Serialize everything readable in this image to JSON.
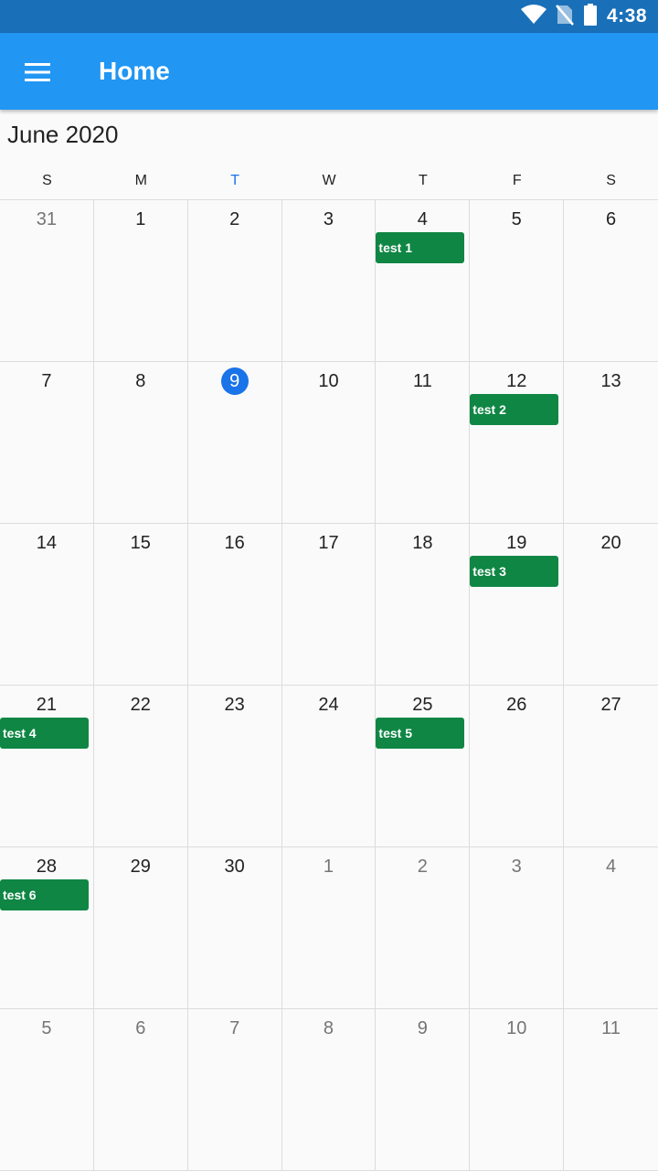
{
  "status_bar": {
    "time": "4:38"
  },
  "app_bar": {
    "title": "Home"
  },
  "calendar": {
    "month_title": "June 2020",
    "weekdays": [
      "S",
      "M",
      "T",
      "W",
      "T",
      "F",
      "S"
    ],
    "today_weekday_index": 2,
    "colors": {
      "today": "#1a73e8",
      "event": "#0f8644",
      "app_bar": "#2196f3"
    },
    "weeks": [
      [
        {
          "day": "31",
          "current_month": false
        },
        {
          "day": "1",
          "current_month": true
        },
        {
          "day": "2",
          "current_month": true
        },
        {
          "day": "3",
          "current_month": true
        },
        {
          "day": "4",
          "current_month": true,
          "event": "test 1"
        },
        {
          "day": "5",
          "current_month": true
        },
        {
          "day": "6",
          "current_month": true
        }
      ],
      [
        {
          "day": "7",
          "current_month": true
        },
        {
          "day": "8",
          "current_month": true
        },
        {
          "day": "9",
          "current_month": true,
          "today": true
        },
        {
          "day": "10",
          "current_month": true
        },
        {
          "day": "11",
          "current_month": true
        },
        {
          "day": "12",
          "current_month": true,
          "event": "test 2"
        },
        {
          "day": "13",
          "current_month": true
        }
      ],
      [
        {
          "day": "14",
          "current_month": true
        },
        {
          "day": "15",
          "current_month": true
        },
        {
          "day": "16",
          "current_month": true
        },
        {
          "day": "17",
          "current_month": true
        },
        {
          "day": "18",
          "current_month": true
        },
        {
          "day": "19",
          "current_month": true,
          "event": "test 3"
        },
        {
          "day": "20",
          "current_month": true
        }
      ],
      [
        {
          "day": "21",
          "current_month": true,
          "event": "test 4"
        },
        {
          "day": "22",
          "current_month": true
        },
        {
          "day": "23",
          "current_month": true
        },
        {
          "day": "24",
          "current_month": true
        },
        {
          "day": "25",
          "current_month": true,
          "event": "test 5"
        },
        {
          "day": "26",
          "current_month": true
        },
        {
          "day": "27",
          "current_month": true
        }
      ],
      [
        {
          "day": "28",
          "current_month": true,
          "event": "test 6"
        },
        {
          "day": "29",
          "current_month": true
        },
        {
          "day": "30",
          "current_month": true
        },
        {
          "day": "1",
          "current_month": false
        },
        {
          "day": "2",
          "current_month": false
        },
        {
          "day": "3",
          "current_month": false
        },
        {
          "day": "4",
          "current_month": false
        }
      ],
      [
        {
          "day": "5",
          "current_month": false
        },
        {
          "day": "6",
          "current_month": false
        },
        {
          "day": "7",
          "current_month": false
        },
        {
          "day": "8",
          "current_month": false
        },
        {
          "day": "9",
          "current_month": false
        },
        {
          "day": "10",
          "current_month": false
        },
        {
          "day": "11",
          "current_month": false
        }
      ]
    ]
  }
}
